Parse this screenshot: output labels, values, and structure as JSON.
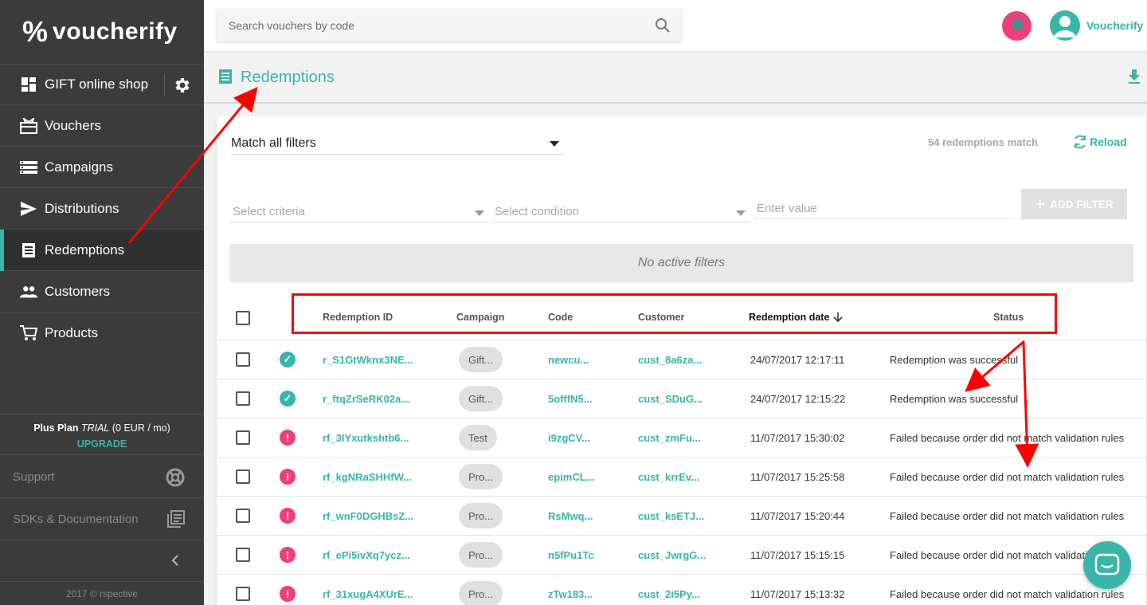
{
  "brand": {
    "logo_text": "voucherify",
    "logo_mark": "%",
    "accent": "#39b5a9",
    "alert": "#ec407a"
  },
  "sidebar": {
    "shop": "GIFT online shop",
    "items": [
      {
        "label": "Vouchers",
        "icon": "voucher-icon"
      },
      {
        "label": "Campaigns",
        "icon": "campaigns-icon"
      },
      {
        "label": "Distributions",
        "icon": "send-icon"
      },
      {
        "label": "Redemptions",
        "icon": "receipt-icon",
        "active": true
      },
      {
        "label": "Customers",
        "icon": "people-icon"
      },
      {
        "label": "Products",
        "icon": "cart-icon"
      }
    ],
    "plan_name": "Plus Plan",
    "plan_trial": "TRIAL",
    "plan_price": "(0 EUR / mo)",
    "upgrade": "UPGRADE",
    "support": "Support",
    "sdks": "SDKs & Documentation",
    "copyright": "2017 © rspective"
  },
  "topbar": {
    "search_placeholder": "Search vouchers by code",
    "username": "Voucherify"
  },
  "page": {
    "title": "Redemptions",
    "match_filter": "Match all filters",
    "count": "54 redemptions match",
    "reload": "Reload",
    "select_criteria": "Select criteria",
    "select_condition": "Select condition",
    "enter_value": "Enter value",
    "add_filter": "ADD FILTER",
    "no_filters": "No active filters"
  },
  "table": {
    "headers": {
      "id": "Redemption ID",
      "campaign": "Campaign",
      "code": "Code",
      "customer": "Customer",
      "date": "Redemption date",
      "status": "Status"
    },
    "rows": [
      {
        "ok": true,
        "id": "r_S1GtWknx3NE...",
        "campaign": "Gift...",
        "code": "newcu...",
        "customer": "cust_8a6za...",
        "date": "24/07/2017 12:17:11",
        "status": "Redemption was successful"
      },
      {
        "ok": true,
        "id": "r_ftqZrSeRK02a...",
        "campaign": "Gift...",
        "code": "5offfN5...",
        "customer": "cust_SDuG...",
        "date": "24/07/2017 12:15:22",
        "status": "Redemption was successful"
      },
      {
        "ok": false,
        "id": "rf_3lYxutkshtb6...",
        "campaign": "Test",
        "code": "i9zgCV...",
        "customer": "cust_zmFu...",
        "date": "11/07/2017 15:30:02",
        "status": "Failed because order did not match validation rules"
      },
      {
        "ok": false,
        "id": "rf_kgNRaSHHfW...",
        "campaign": "Pro...",
        "code": "epimCL...",
        "customer": "cust_krrEv...",
        "date": "11/07/2017 15:25:58",
        "status": "Failed because order did not match validation rules"
      },
      {
        "ok": false,
        "id": "rf_wnF0DGHBsZ...",
        "campaign": "Pro...",
        "code": "RsMwq...",
        "customer": "cust_ksETJ...",
        "date": "11/07/2017 15:20:44",
        "status": "Failed because order did not match validation rules"
      },
      {
        "ok": false,
        "id": "rf_ePi5ivXq7ycz...",
        "campaign": "Pro...",
        "code": "n5fPu1Tc",
        "customer": "cust_JwrgG...",
        "date": "11/07/2017 15:15:15",
        "status": "Failed because order did not match validation rules"
      },
      {
        "ok": false,
        "id": "rf_31xugA4XUrE...",
        "campaign": "Pro...",
        "code": "zTw183...",
        "customer": "cust_2i5Py...",
        "date": "11/07/2017 15:13:32",
        "status": "Failed because order did not match validation rules"
      }
    ]
  }
}
